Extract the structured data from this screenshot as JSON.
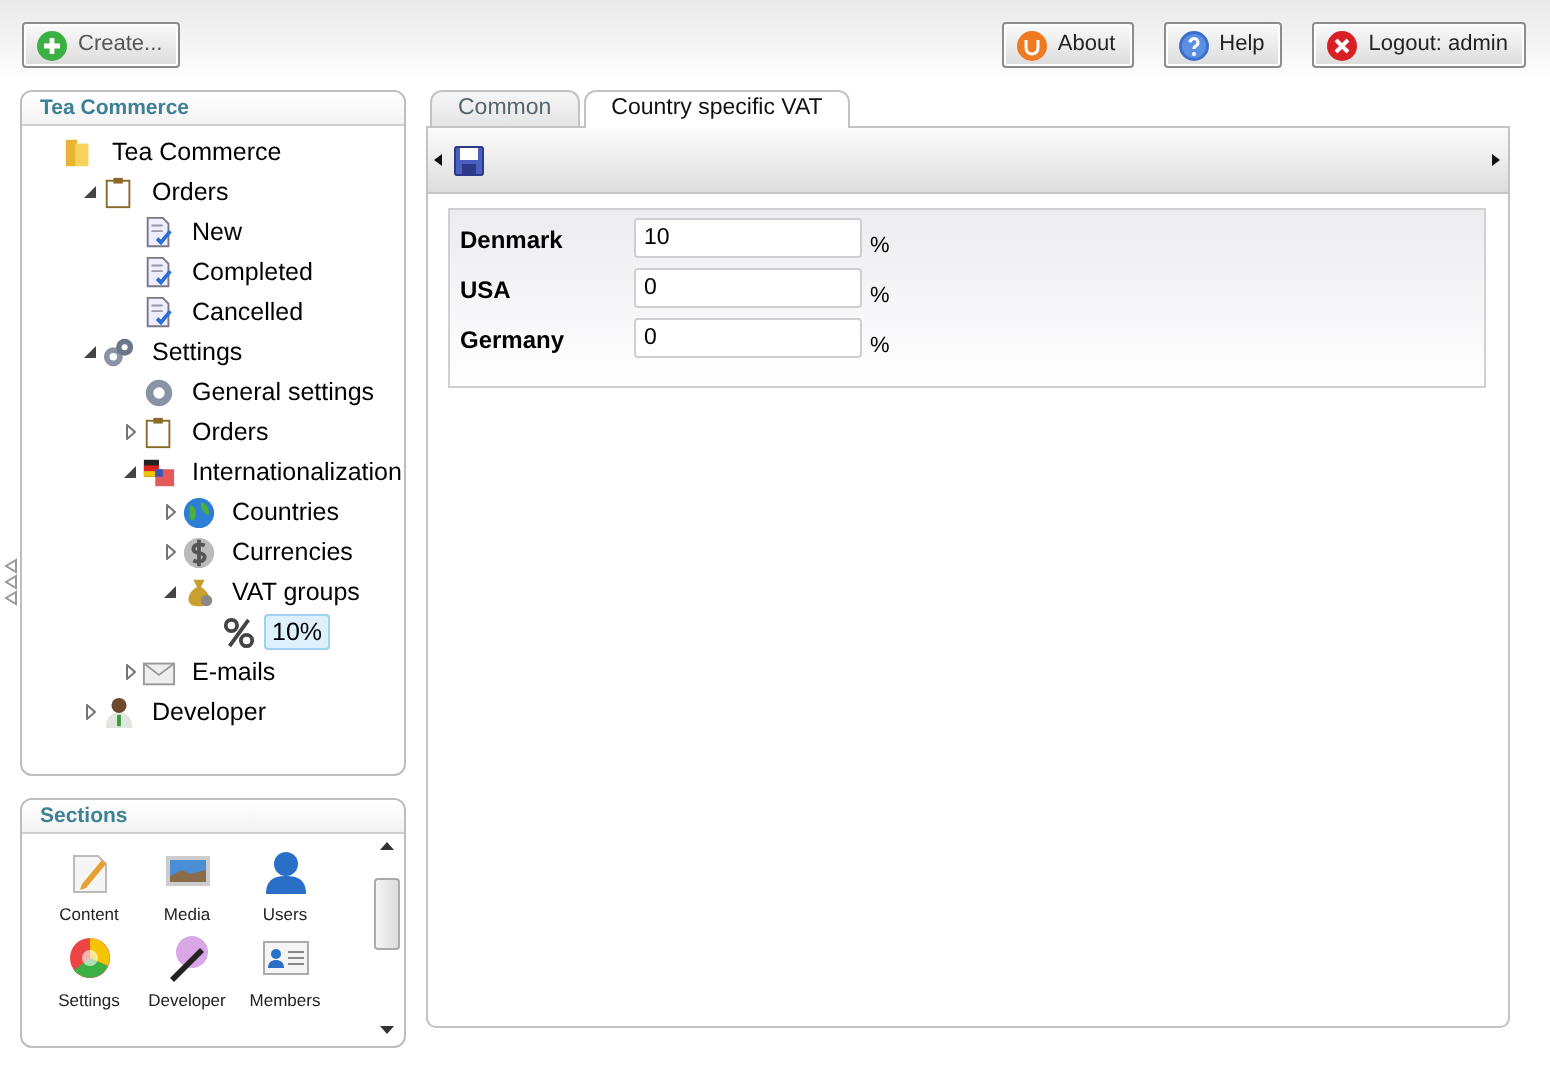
{
  "header": {
    "create_button": "Create...",
    "buttons": [
      {
        "kind": "about",
        "label": "About"
      },
      {
        "kind": "help",
        "label": "Help"
      },
      {
        "kind": "logout",
        "label": "Logout: admin"
      }
    ]
  },
  "tree_panel": {
    "title": "Tea Commerce",
    "tree": [
      {
        "label": "Tea Commerce",
        "kind": "folder",
        "selected": false,
        "children": [
          {
            "label": "Orders",
            "kind": "clipboard",
            "selected": false,
            "expanded": true,
            "children": [
              {
                "label": "New",
                "kind": "document",
                "selected": false
              },
              {
                "label": "Completed",
                "kind": "document",
                "selected": false
              },
              {
                "label": "Cancelled",
                "kind": "document",
                "selected": false
              }
            ]
          },
          {
            "label": "Settings",
            "kind": "gears",
            "selected": false,
            "expanded": true,
            "children": [
              {
                "label": "General settings",
                "kind": "gear",
                "selected": false
              },
              {
                "label": "Orders",
                "kind": "clipboard",
                "selected": false,
                "expanded": false
              },
              {
                "label": "Internationalization",
                "kind": "flags",
                "selected": false,
                "expanded": true,
                "children": [
                  {
                    "label": "Countries",
                    "kind": "globe",
                    "selected": false,
                    "expanded": false
                  },
                  {
                    "label": "Currencies",
                    "kind": "dollar",
                    "selected": false,
                    "expanded": false
                  },
                  {
                    "label": "VAT groups",
                    "kind": "moneybag",
                    "selected": false,
                    "expanded": true,
                    "children": [
                      {
                        "label": "10%",
                        "kind": "percent",
                        "selected": true
                      }
                    ]
                  }
                ]
              },
              {
                "label": "E-mails",
                "kind": "envelope",
                "selected": false,
                "expanded": false
              }
            ]
          },
          {
            "label": "Developer",
            "kind": "person",
            "selected": false,
            "expanded": false
          }
        ]
      }
    ]
  },
  "sections_panel": {
    "title": "Sections",
    "items": [
      {
        "label": "Content",
        "kind": "content"
      },
      {
        "label": "Media",
        "kind": "media"
      },
      {
        "label": "Users",
        "kind": "users"
      },
      {
        "label": "Settings",
        "kind": "settings"
      },
      {
        "label": "Developer",
        "kind": "developer"
      },
      {
        "label": "Members",
        "kind": "members"
      }
    ]
  },
  "tabs": [
    {
      "label": "Common",
      "selected": false
    },
    {
      "label": "Country specific VAT",
      "selected": true
    }
  ],
  "vat_rows": [
    {
      "country": "Denmark",
      "value": "10",
      "unit": "%"
    },
    {
      "country": "USA",
      "value": "0",
      "unit": "%"
    },
    {
      "country": "Germany",
      "value": "0",
      "unit": "%"
    }
  ]
}
